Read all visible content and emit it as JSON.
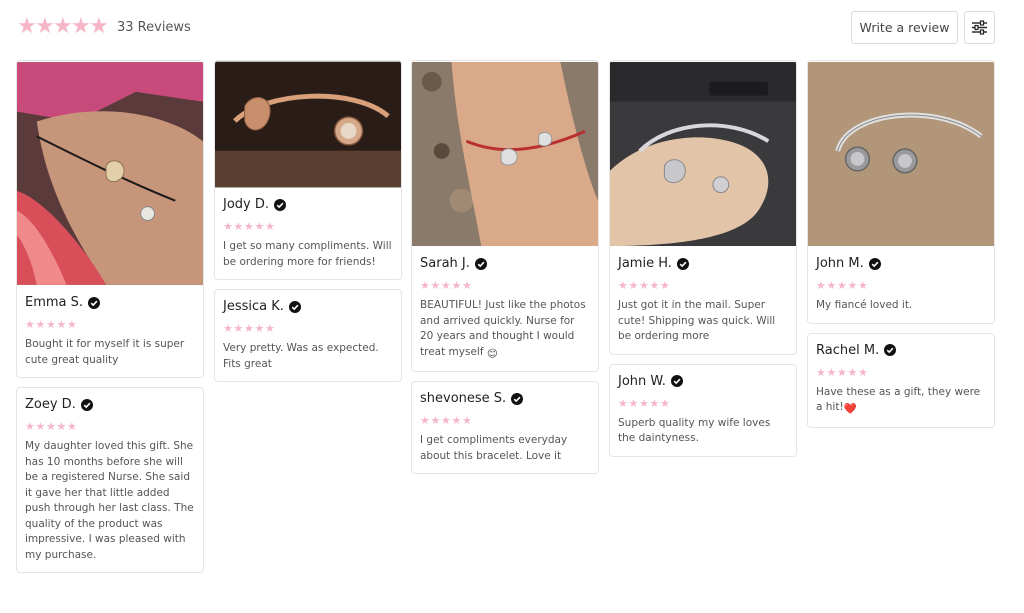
{
  "summary": {
    "stars": [
      "★",
      "★",
      "★",
      "★",
      "★"
    ],
    "count_text": "33 Reviews"
  },
  "actions": {
    "write_label": "Write a review",
    "filter_icon": "sliders-icon"
  },
  "colors": {
    "star": "#f5b7c8",
    "border": "#e5e5e5",
    "text": "#555555"
  },
  "columns": [
    [
      {
        "name": "Emma S.",
        "rating": 5,
        "text": "Bought it for myself it is super cute great quality",
        "photo": "wrist-bracelet-photo"
      },
      {
        "name": "Zoey D.",
        "rating": 5,
        "text": "My daughter loved this gift. She has 10 months before she will be a registered Nurse. She said it gave her that little added push through her last class. The quality of the product was impressive. I was pleased with my purchase."
      }
    ],
    [
      {
        "name": "Jody D.",
        "rating": 5,
        "text": "I get so many compliments. Will be ordering more for friends!",
        "photo": "rose-gold-bracelet-photo"
      },
      {
        "name": "Jessica K.",
        "rating": 5,
        "text": "Very pretty. Was as expected. Fits great"
      }
    ],
    [
      {
        "name": "Sarah J.",
        "rating": 5,
        "text": "BEAUTIFUL! Just like the photos and arrived quickly. Nurse for 20 years and thought I would treat myself",
        "emoji": "😊",
        "photo": "granite-wrist-photo"
      },
      {
        "name": "shevonese S.",
        "rating": 5,
        "text": "I get compliments everyday about this bracelet. Love it"
      }
    ],
    [
      {
        "name": "Jamie H.",
        "rating": 5,
        "text": "Just got it in the mail. Super cute! Shipping was quick. Will be ordering more",
        "photo": "hand-bracelet-photo"
      },
      {
        "name": "John W.",
        "rating": 5,
        "text": "Superb quality my wife loves the daintyness."
      }
    ],
    [
      {
        "name": "John M.",
        "rating": 5,
        "text": "My fiancé loved it.",
        "photo": "silver-bracelet-photo"
      },
      {
        "name": "Rachel M.",
        "rating": 5,
        "text": "Have these as a gift, they were a hit!",
        "emoji": "❤️"
      }
    ]
  ]
}
